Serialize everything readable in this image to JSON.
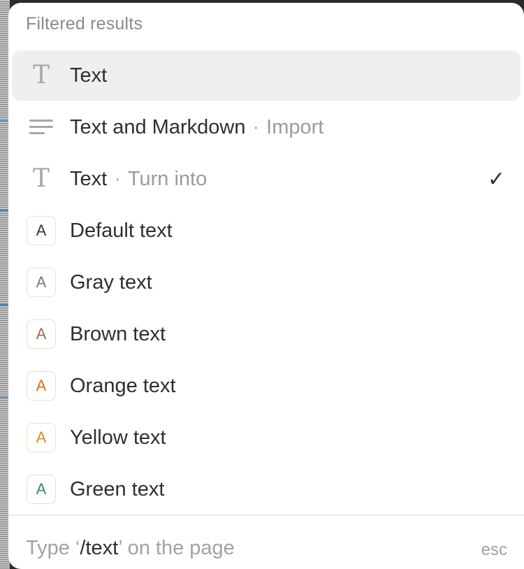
{
  "menu": {
    "section_title": "Filtered results",
    "items": [
      {
        "label": "Text",
        "sub": "",
        "icon": "text-type-icon",
        "selected": true,
        "checked": false
      },
      {
        "label": "Text and Markdown",
        "sub": "Import",
        "icon": "lines-icon",
        "selected": false,
        "checked": false
      },
      {
        "label": "Text",
        "sub": "Turn into",
        "icon": "text-type-icon",
        "selected": false,
        "checked": true
      },
      {
        "label": "Default text",
        "sub": "",
        "icon": "letter-a-icon",
        "color": "#37352f",
        "border": "#e3e2e0",
        "selected": false
      },
      {
        "label": "Gray text",
        "sub": "",
        "icon": "letter-a-icon",
        "color": "#787774",
        "border": "#e3e2e0",
        "selected": false
      },
      {
        "label": "Brown text",
        "sub": "",
        "icon": "letter-a-icon",
        "color": "#9f6b53",
        "border": "#ecdcd4",
        "selected": false
      },
      {
        "label": "Orange text",
        "sub": "",
        "icon": "letter-a-icon",
        "color": "#d9730d",
        "border": "#f5dcc6",
        "selected": false
      },
      {
        "label": "Yellow text",
        "sub": "",
        "icon": "letter-a-icon",
        "color": "#cb912f",
        "border": "#f3e3c3",
        "selected": false
      },
      {
        "label": "Green text",
        "sub": "",
        "icon": "letter-a-icon",
        "color": "#448361",
        "border": "#d6e7dc",
        "selected": false
      }
    ],
    "separator": "·",
    "check_glyph": "✓",
    "letter_glyph": "A",
    "text_icon_glyph": "T"
  },
  "footer": {
    "hint_prefix": "Type ‘",
    "hint_command": "/text",
    "hint_suffix": "’ on the page",
    "esc_label": "esc"
  }
}
